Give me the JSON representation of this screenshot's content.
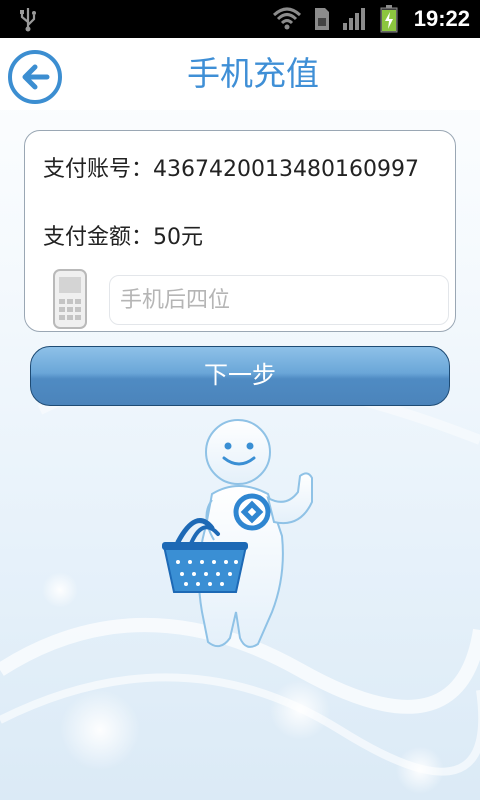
{
  "status_bar": {
    "time": "19:22"
  },
  "header": {
    "title": "手机充值"
  },
  "card": {
    "account_label": "支付账号：4367420013480160997",
    "amount_label": "支付金额：50元",
    "phone_input": {
      "value": "",
      "placeholder": "手机后四位"
    }
  },
  "next_button": {
    "label": "下一步"
  },
  "colors": {
    "accent": "#3f8fd6",
    "button": "#5b97cf"
  }
}
